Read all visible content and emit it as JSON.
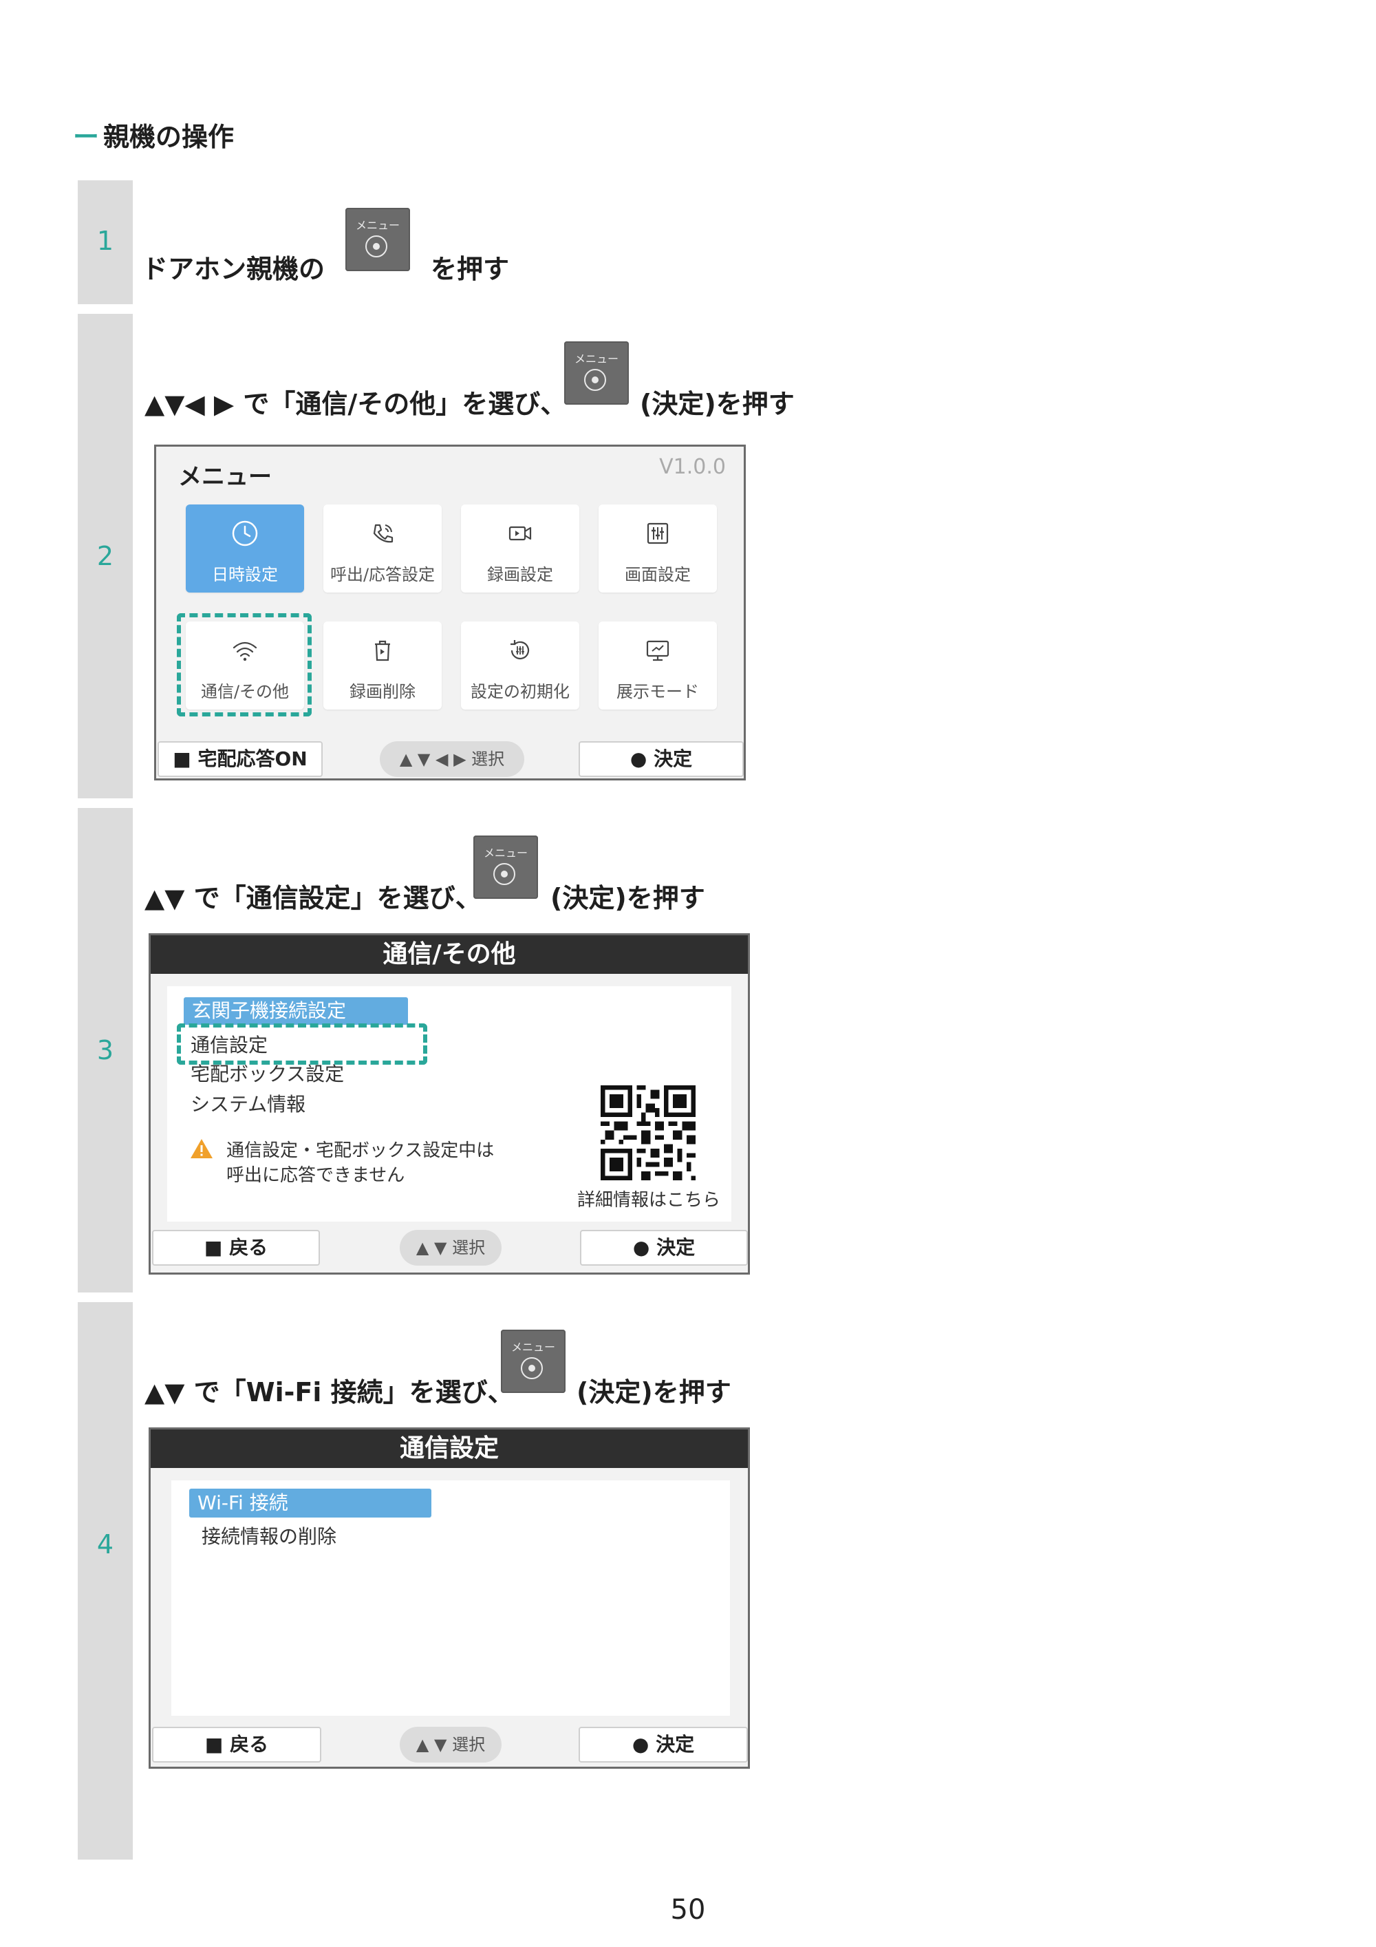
{
  "heading": {
    "dash": "ー",
    "title": "親機の操作"
  },
  "menu_button": {
    "label": "メニュー"
  },
  "steps": [
    {
      "number": "1",
      "text_before": "ドアホン親機の",
      "text_after": "を押す"
    },
    {
      "number": "2",
      "text_before": "▲▼◀ ▶ で「通信/その他」を選び、",
      "text_after": "(決定)を押す",
      "screen": {
        "title": "メニュー",
        "version": "V1.0.0",
        "tiles": [
          {
            "label": "日時設定",
            "icon": "clock-icon"
          },
          {
            "label": "呼出/応答設定",
            "icon": "phone-icon"
          },
          {
            "label": "録画設定",
            "icon": "video-camera-icon"
          },
          {
            "label": "画面設定",
            "icon": "sliders-icon"
          },
          {
            "label": "通信/その他",
            "icon": "wifi-icon"
          },
          {
            "label": "録画削除",
            "icon": "trash-icon"
          },
          {
            "label": "設定の初期化",
            "icon": "reset-icon"
          },
          {
            "label": "展示モード",
            "icon": "display-icon"
          }
        ],
        "left_key": "■ 宅配応答ON",
        "center_key": "▲ ▼ ◀ ▶ 選択",
        "right_key": "● 決定"
      }
    },
    {
      "number": "3",
      "text_before": "▲▼ で「通信設定」を選び、",
      "text_after": "(決定)を押す",
      "screen": {
        "title": "通信/その他",
        "items": [
          "玄関子機接続設定",
          "通信設定",
          "宅配ボックス設定",
          "システム情報"
        ],
        "warning_line1": "通信設定・宅配ボックス設定中は",
        "warning_line2": "呼出に応答できません",
        "qr_caption": "詳細情報はこちら",
        "left_key": "■ 戻る",
        "center_key": "▲ ▼ 選択",
        "right_key": "● 決定"
      }
    },
    {
      "number": "4",
      "text_before": "▲▼ で「Wi-Fi 接続」を選び、",
      "text_after": "(決定)を押す",
      "screen": {
        "title": "通信設定",
        "items": [
          "Wi-Fi 接続",
          "接続情報の削除"
        ],
        "left_key": "■ 戻る",
        "center_key": "▲ ▼ 選択",
        "right_key": "● 決定"
      }
    }
  ],
  "page_number": "50",
  "colors": {
    "accent": "#2aa79a",
    "selected": "#62ace0",
    "active_tile": "#5fa9e6"
  }
}
